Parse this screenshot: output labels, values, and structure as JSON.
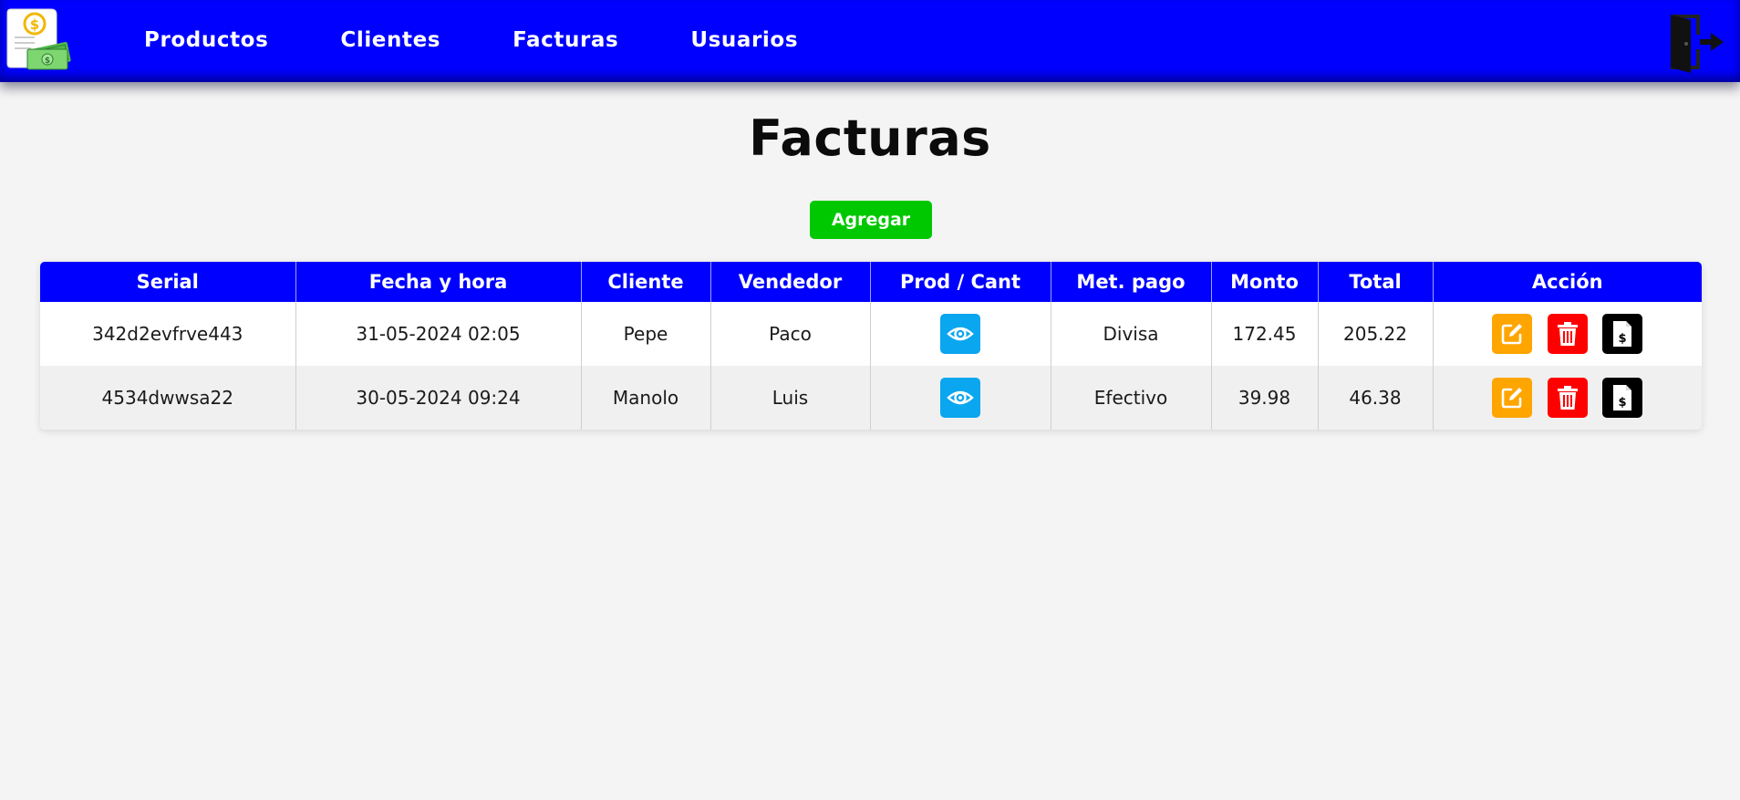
{
  "nav": {
    "links": [
      "Productos",
      "Clientes",
      "Facturas",
      "Usuarios"
    ]
  },
  "icons": {
    "logo": "invoice-money-logo",
    "logout": "logout-door-icon",
    "view": "eye-icon",
    "edit": "edit-icon",
    "delete": "trash-icon",
    "invoice": "invoice-document-icon"
  },
  "colors": {
    "nav_bg": "#0000ff",
    "add_button": "#00c800",
    "view_button": "#0aa6ef",
    "edit_button": "#ffa500",
    "delete_button": "#ff0000",
    "invoice_button": "#000000"
  },
  "page": {
    "title": "Facturas",
    "add_label": "Agregar"
  },
  "table": {
    "headers": [
      "Serial",
      "Fecha y hora",
      "Cliente",
      "Vendedor",
      "Prod / Cant",
      "Met. pago",
      "Monto",
      "Total",
      "Acción"
    ],
    "rows": [
      {
        "serial": "342d2evfrve443",
        "datetime": "31-05-2024 02:05",
        "client": "Pepe",
        "seller": "Paco",
        "payment": "Divisa",
        "amount": "172.45",
        "total": "205.22"
      },
      {
        "serial": "4534dwwsa22",
        "datetime": "30-05-2024 09:24",
        "client": "Manolo",
        "seller": "Luis",
        "payment": "Efectivo",
        "amount": "39.98",
        "total": "46.38"
      }
    ]
  }
}
